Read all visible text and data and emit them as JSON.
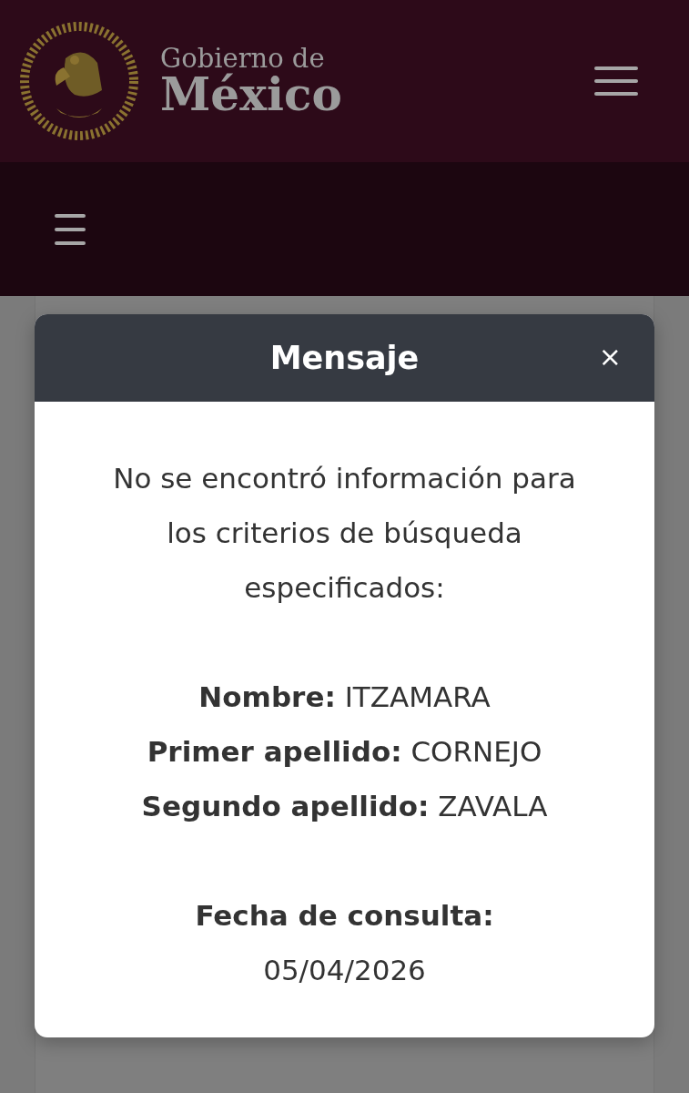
{
  "header": {
    "logo_line1": "Gobierno de",
    "logo_line2": "México"
  },
  "modal": {
    "title": "Mensaje",
    "close": "×",
    "message": "No se encontró información para los criterios de búsqueda especificados:",
    "criteria": [
      "**Nombre:** ITZAMARA",
      "**Primer apellido:** CORNEJO",
      "**Segundo apellido:** ZAVALA"
    ],
    "date_label": "Fecha de consulta:",
    "date": "05/04/2026"
  }
}
